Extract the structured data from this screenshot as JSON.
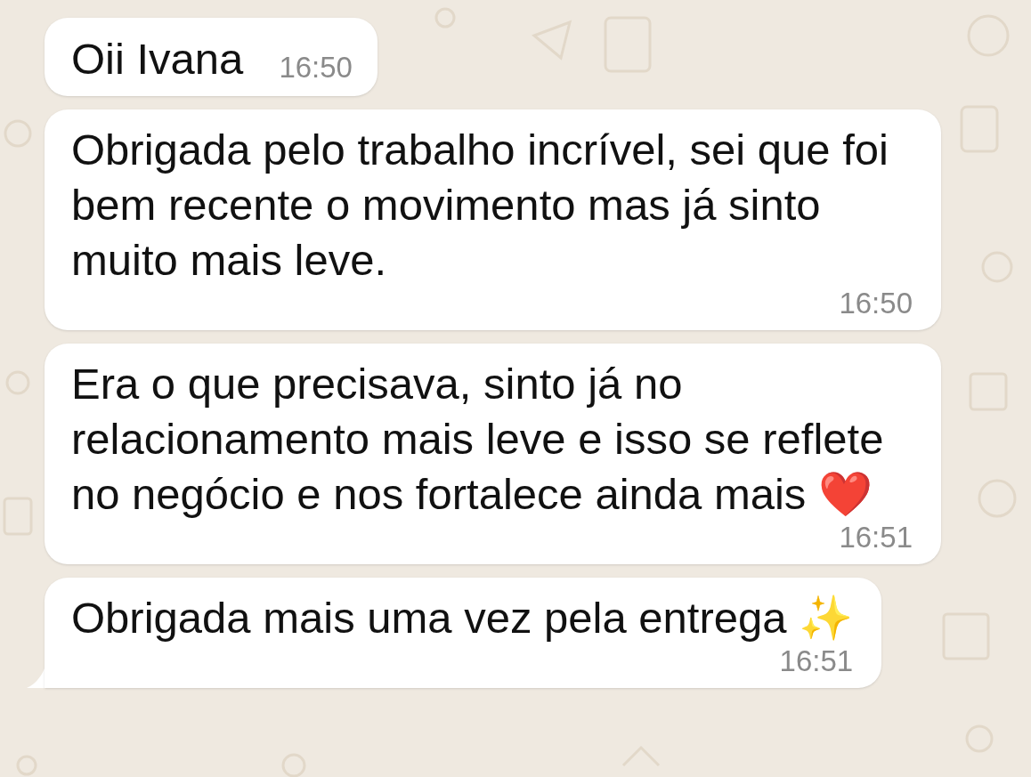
{
  "messages": [
    {
      "text": "Oii Ivana",
      "time": "16:50",
      "tail": false
    },
    {
      "text": "Obrigada pelo trabalho incrível, sei que foi bem recente o movimento mas já sinto muito mais leve.",
      "time": "16:50",
      "tail": false
    },
    {
      "text": "Era o que precisava, sinto já no relacionamento mais leve e isso se reflete no negócio e nos fortalece ainda mais ❤️",
      "time": "16:51",
      "tail": false
    },
    {
      "text": "Obrigada mais uma vez pela entrega ✨",
      "time": "16:51",
      "tail": true
    }
  ]
}
